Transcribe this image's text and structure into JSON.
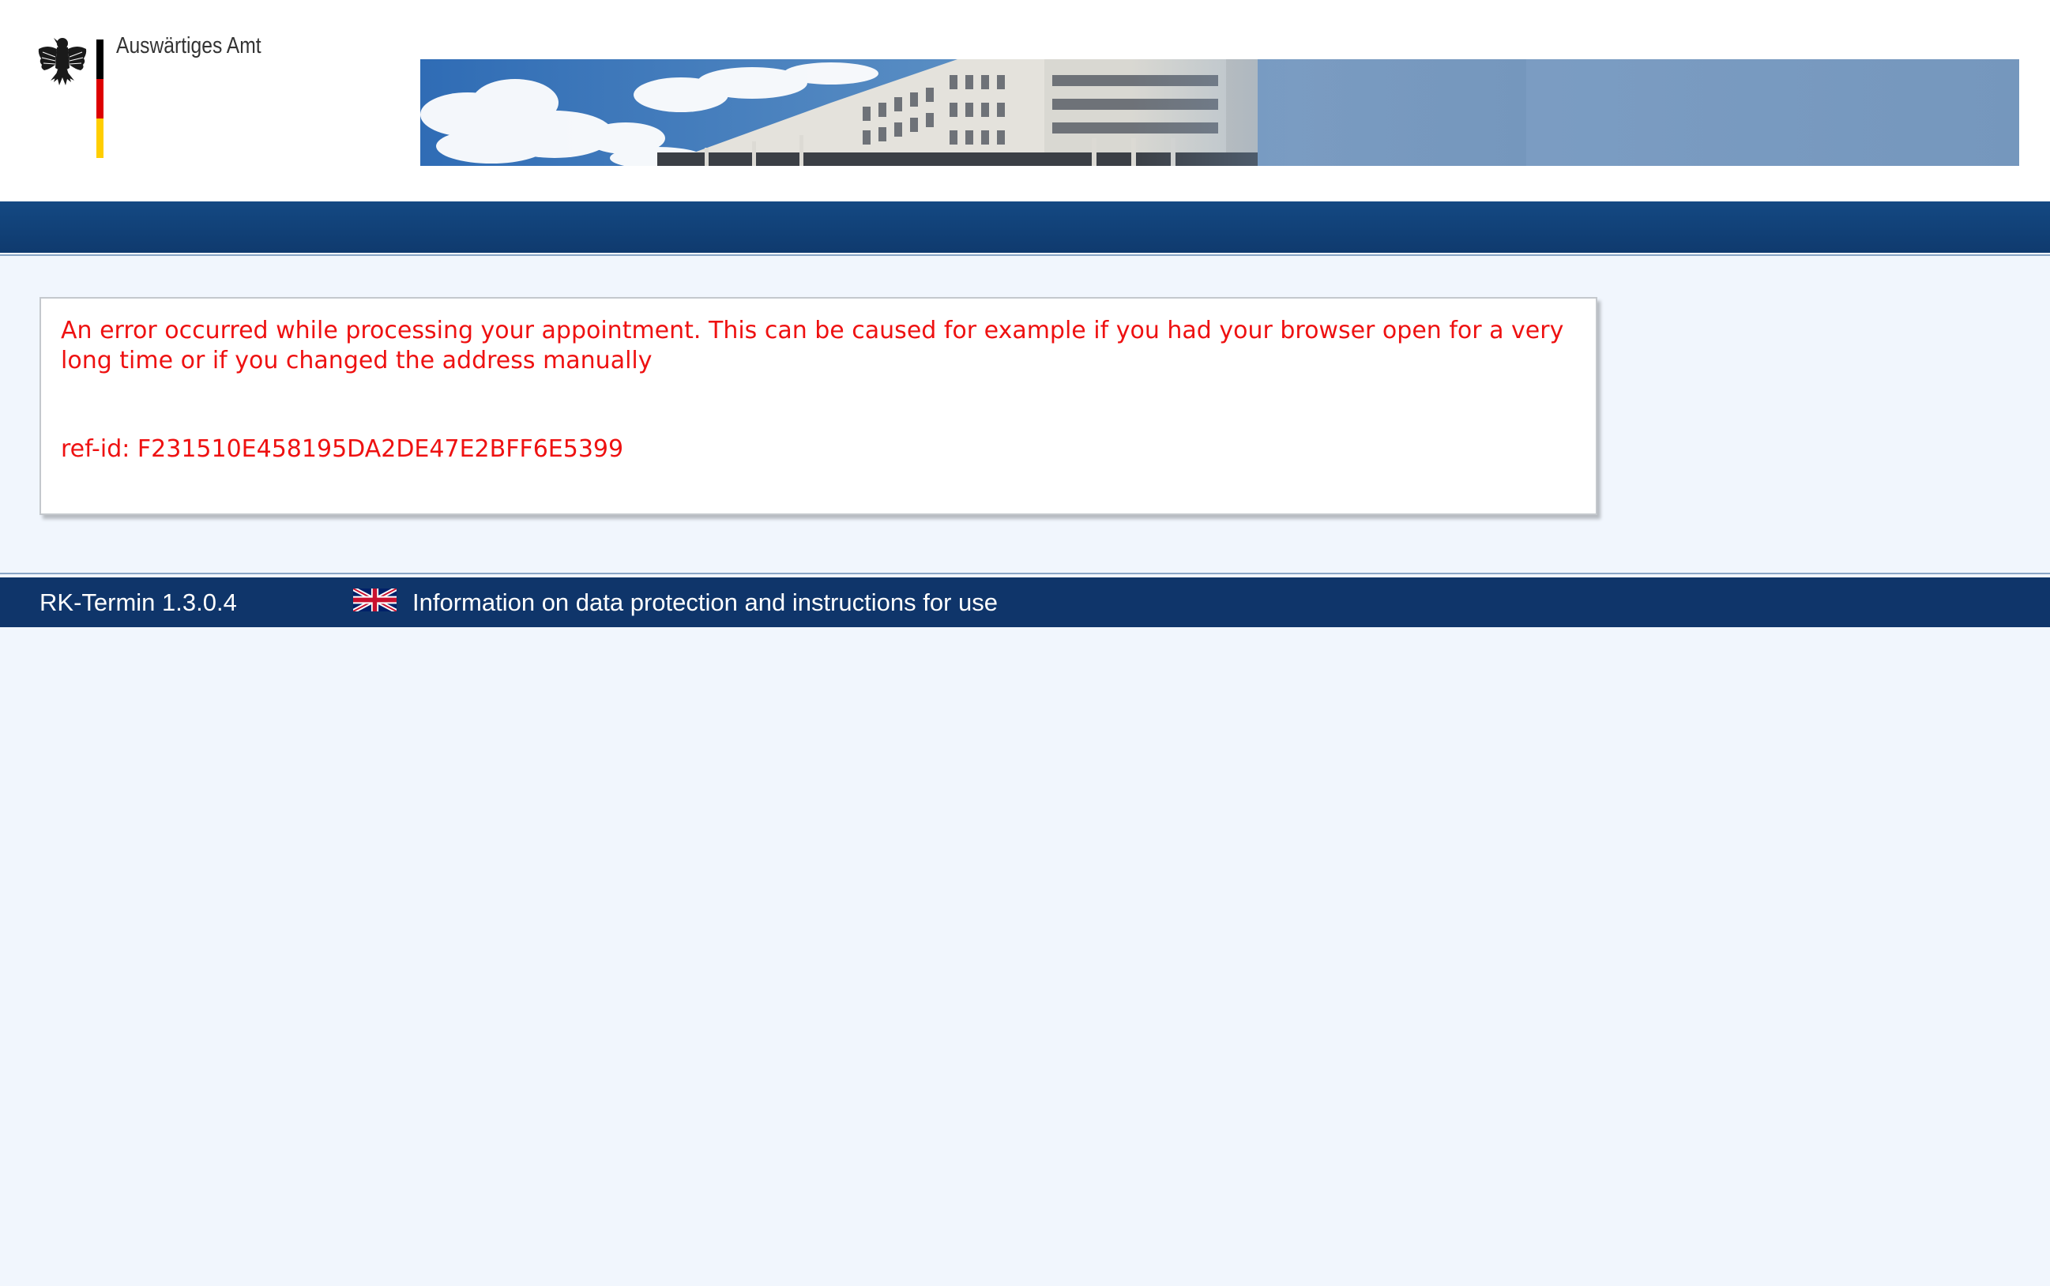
{
  "header": {
    "logo_text": "Auswärtiges Amt",
    "flag_colors": [
      "#000000",
      "#dd0000",
      "#ffce00"
    ],
    "banner_icon": "building-photo-icon"
  },
  "error": {
    "message": "An error occurred while processing your appointment. This can be caused for example if you had your browser open for a very long time or if you changed the address manually",
    "ref_id": "ref-id: F231510E458195DA2DE47E2BFF6E5399",
    "color": "#ee1111"
  },
  "footer": {
    "version": "RK-Termin 1.3.0.4",
    "language_icon": "uk-flag-icon",
    "info_link": "Information on data protection and instructions for use"
  },
  "colors": {
    "nav_bar": "#144983",
    "footer_bar": "#0f356a",
    "page_background": "#f1f6fd"
  }
}
